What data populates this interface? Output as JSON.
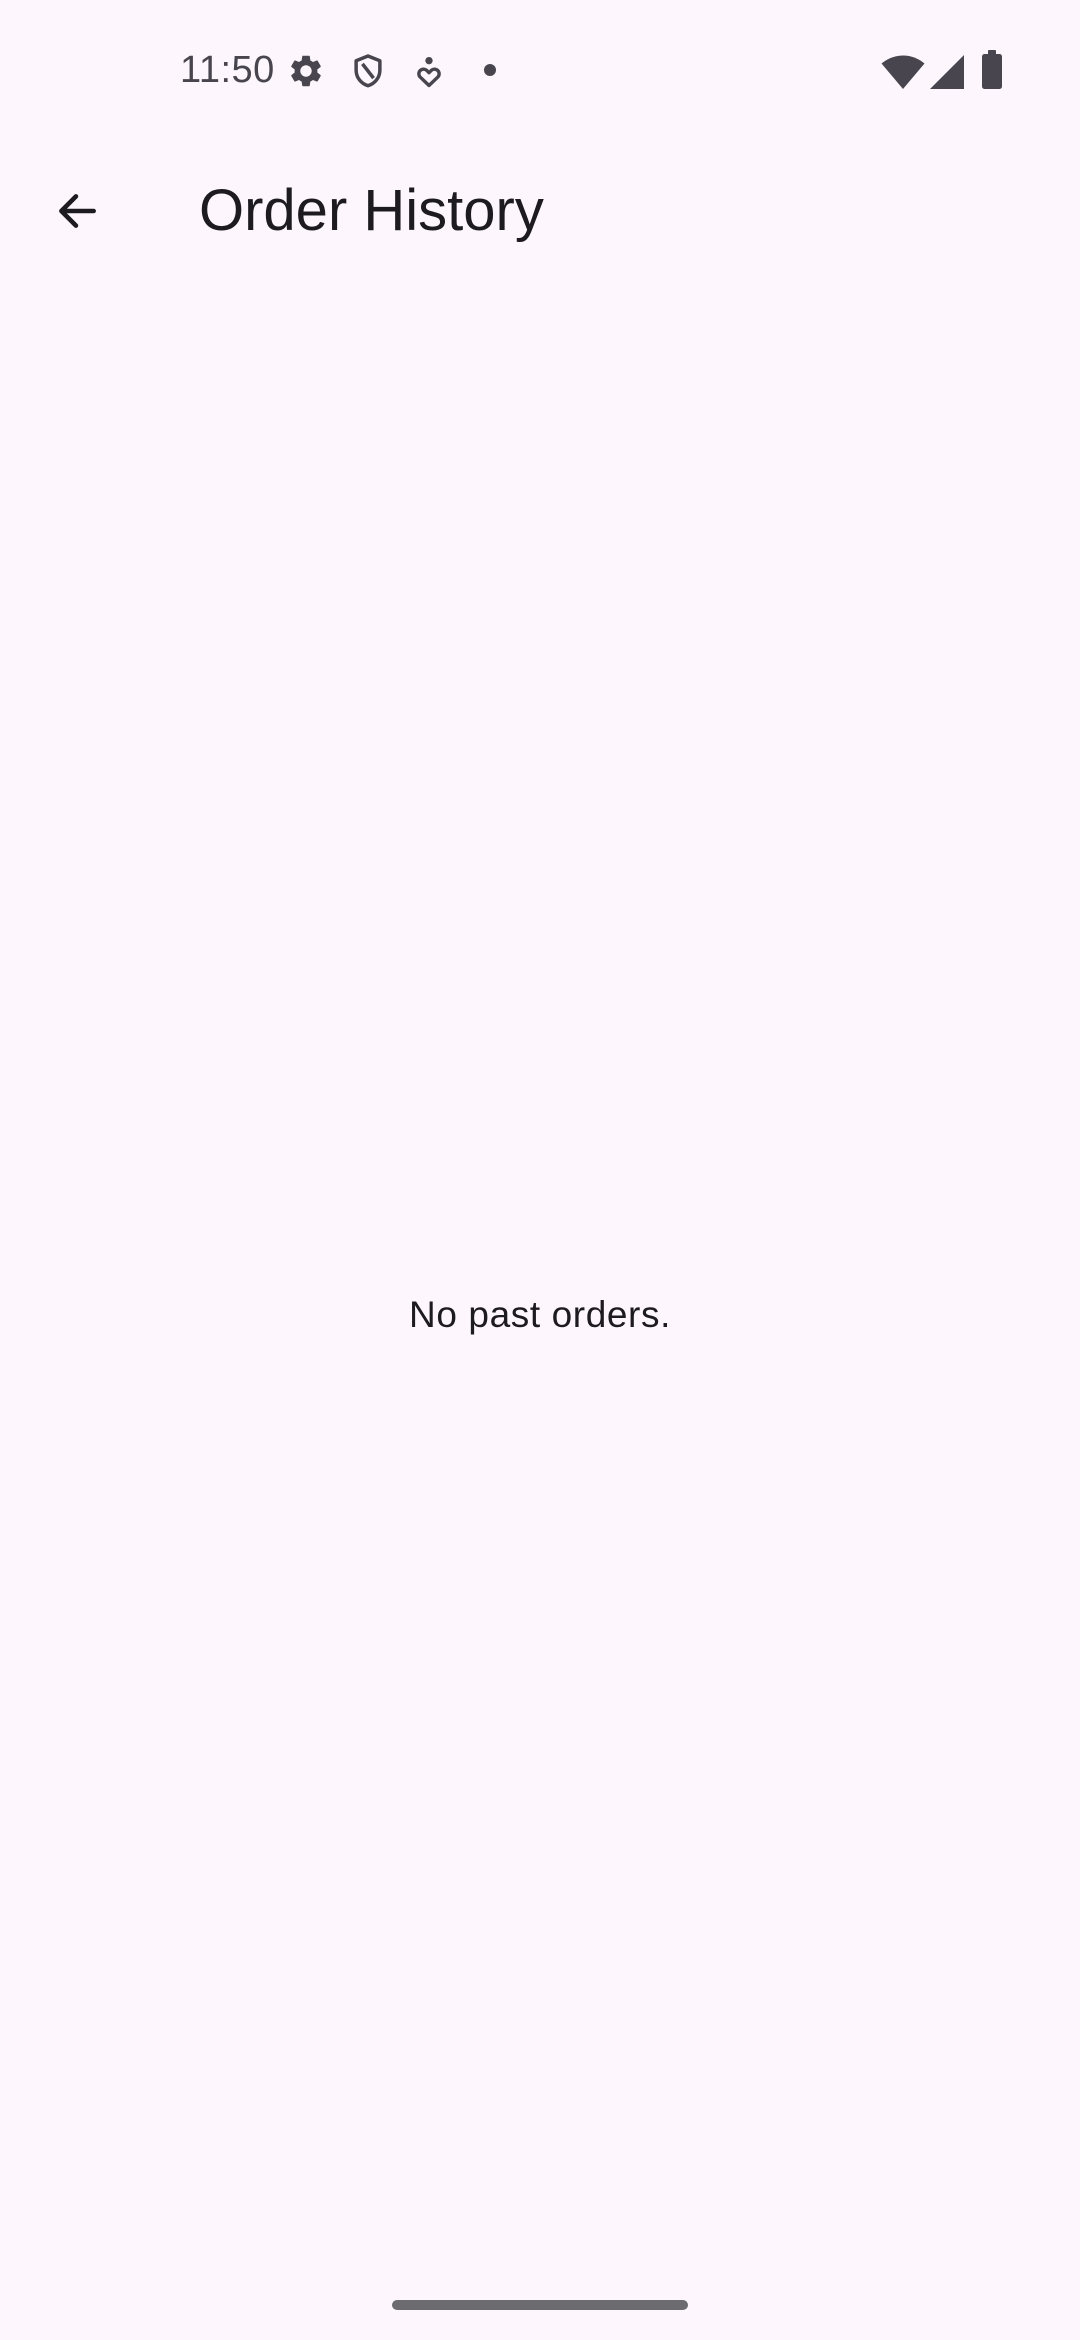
{
  "status_bar": {
    "time": "11:50",
    "left_icons": [
      "gear-icon",
      "shield-icon",
      "accessibility-icon",
      "notification-dot-icon"
    ],
    "right_icons": [
      "wifi-icon",
      "cellular-signal-icon",
      "battery-icon"
    ]
  },
  "app_bar": {
    "back_icon": "arrow-back-icon",
    "title": "Order History"
  },
  "content": {
    "empty_message": "No past orders."
  },
  "colors": {
    "background": "#fdf7fd",
    "text_primary": "#1d1b20",
    "status_icons": "#49454f",
    "home_indicator": "#6b6b70"
  }
}
